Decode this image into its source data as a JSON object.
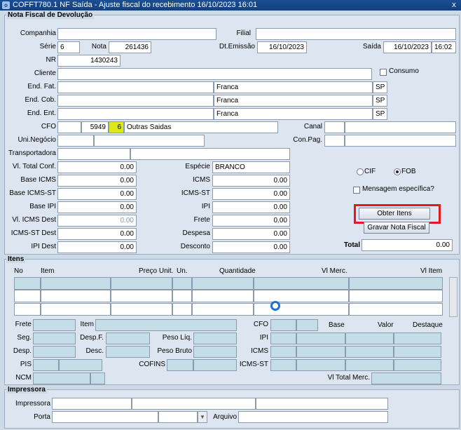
{
  "window": {
    "title": "COFFT780.1   NF Saída - Ajuste fiscal do recebimento    16/10/2023 16:01",
    "close": "x"
  },
  "nota": {
    "group_title": "Nota Fiscal de Devolução",
    "labels": {
      "companhia": "Companhia",
      "filial": "Filial",
      "serie": "Série",
      "nota": "Nota",
      "dt_emissao": "Dt.Emissão",
      "saida": "Saída",
      "nr": "NR",
      "cliente": "Cliente",
      "consumo": "Consumo",
      "end_fat": "End. Fat.",
      "end_cob": "End. Cob.",
      "end_ent": "End. Ent.",
      "cfo": "CFO",
      "canal": "Canal",
      "uni_negocio": "Uni.Negócio",
      "con_pag": "Con.Pag.",
      "transportadora": "Transportadora",
      "vl_total_conf": "Vl. Total Conf.",
      "especie": "Espécie",
      "base_icms": "Base ICMS",
      "icms": "ICMS",
      "base_icms_st": "Base ICMS-ST",
      "icms_st": "ICMS-ST",
      "base_ipi": "Base IPI",
      "ipi": "IPI",
      "vl_icms_dest": "Vl. ICMS Dest",
      "frete": "Frete",
      "icms_st_dest": "ICMS-ST Dest",
      "despesa": "Despesa",
      "ipi_dest": "IPI Dest",
      "desconto": "Desconto",
      "total": "Total",
      "cif": "CIF",
      "fob": "FOB",
      "mensagem": "Mensagem específica?"
    },
    "values": {
      "serie": "6",
      "nota": "261436",
      "dt_emissao": "16/10/2023",
      "saida_date": "16/10/2023",
      "saida_time": "16:02",
      "nr": "1430243",
      "end_fat_pais": "Franca",
      "end_fat_uf": "SP",
      "end_cob_pais": "Franca",
      "end_cob_uf": "SP",
      "end_ent_pais": "Franca",
      "end_ent_uf": "SP",
      "cfo_code": "5949",
      "cfo_digit": "6",
      "cfo_desc": "Outras Saidas",
      "especie": "BRANCO",
      "vl_total_conf": "0.00",
      "base_icms": "0.00",
      "base_icms_st": "0.00",
      "base_ipi": "0.00",
      "vl_icms_dest": "0.00",
      "icms_st_dest": "0.00",
      "ipi_dest": "0.00",
      "icms": "0.00",
      "icms_st": "0.00",
      "ipi": "0.00",
      "frete": "0.00",
      "despesa": "0.00",
      "desconto": "0.00",
      "total": "0.00"
    },
    "buttons": {
      "obter_itens": "Obter Itens",
      "gravar": "Gravar Nota Fiscal"
    }
  },
  "itens": {
    "group_title": "Itens",
    "columns": {
      "no": "No",
      "item": "Item",
      "preco_unit": "Preço Unit.",
      "un": "Un.",
      "quantidade": "Quantidade",
      "vl_merc": "Vl Merc.",
      "vl_item": "Vl Item"
    },
    "labels": {
      "frete": "Frete",
      "item": "Item",
      "cfo": "CFO",
      "base": "Base",
      "valor": "Valor",
      "destaque": "Destaque",
      "seg": "Seg.",
      "desp_f": "Desp.F.",
      "peso_liq": "Peso Líq.",
      "ipi": "IPI",
      "desp": "Desp.",
      "desc": "Desc.",
      "peso_bruto": "Peso Bruto",
      "icms": "ICMS",
      "pis": "PIS",
      "cofins": "COFINS",
      "icms_st": "ICMS-ST",
      "ncm": "NCM",
      "vl_total_merc": "Vl Total Merc."
    }
  },
  "impressora": {
    "group_title": "Impressora",
    "labels": {
      "impressora": "Impressora",
      "porta": "Porta",
      "arquivo": "Arquivo"
    }
  }
}
